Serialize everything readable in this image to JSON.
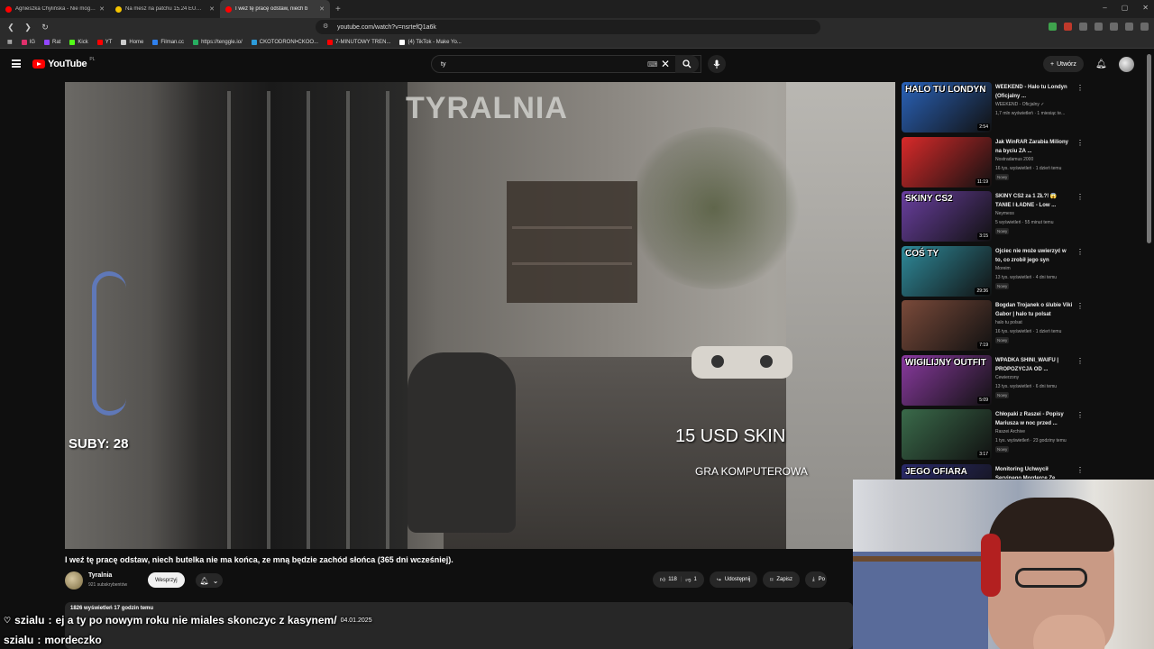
{
  "browser": {
    "tabs": [
      {
        "label": "Agnieszka Chylińska - Nie mogę Cię",
        "color": "#ff0000"
      },
      {
        "label": "Na mesz na patchu 15.24 EUW 767!",
        "color": "#f5c400"
      },
      {
        "label": "I weź tę pracę odstaw, niech b",
        "color": "#ff0000"
      }
    ],
    "active_tab": 2,
    "new_tab": "+",
    "window_controls": [
      "–",
      "▢",
      "✕"
    ],
    "url": "youtube.com/watch?v=nsrtefQ1a6k",
    "bookmarks": [
      {
        "label": "IG",
        "color": "#e1306c"
      },
      {
        "label": "Rat",
        "color": "#9146ff"
      },
      {
        "label": "Kick",
        "color": "#53fc18"
      },
      {
        "label": "YT",
        "color": "#ff0000"
      },
      {
        "label": "Home",
        "color": "#cccccc"
      },
      {
        "label": "Filman.cc",
        "color": "#2f80ed"
      },
      {
        "label": "https://tenggle.io/",
        "color": "#27ae60"
      },
      {
        "label": "CKOTODRONI•CKOO...",
        "color": "#2d9cdb"
      },
      {
        "label": "7-MINUTOWY TREN...",
        "color": "#ff0000"
      },
      {
        "label": "(4) TikTok - Make Yo...",
        "color": "#ffffff"
      }
    ]
  },
  "youtube": {
    "logo_text": "YouTube",
    "country": "PL",
    "search_value": "ty",
    "create_label": "Utwórz",
    "icons": [
      "menu-icon",
      "search-icon",
      "mic-icon",
      "bell-icon",
      "keyboard-icon",
      "clear-icon"
    ]
  },
  "video": {
    "overlay_channel": "TYRALNIA",
    "overlay_subs": "SUBY: 28",
    "overlay_skin": "15 USD SKIN",
    "overlay_game": "GRA KOMPUTEROWA",
    "title": "I weź tę pracę odstaw, niech butelka nie ma końca, ze mną będzie zachód słońca (365 dni wcześniej).",
    "channel": "Tyralnia",
    "subscribers": "921 subskrybentów",
    "support_label": "Wesprzyj",
    "likes": "118",
    "dislikes": "1",
    "share_label": "Udostępnij",
    "save_label": "Zapisz",
    "download_label": "Po",
    "desc_meta": "1826 wyświetleń  17 godzin temu"
  },
  "sidebar": {
    "items": [
      {
        "title": "WEEKEND - Halo tu Londyn (Oficjalny ...",
        "channel": "WEEKEND - Oficjalny ✓",
        "meta": "1,7 mln wyświetleń · 1 miesiąc te...",
        "duration": "2:54",
        "thumb_text": "HALO TU LONDYN",
        "thumb_bg": "#2a62b8",
        "badge": ""
      },
      {
        "title": "Jak WinRAR Zarabia Miliony na byciu ZA ...",
        "channel": "Nostradamus 2000",
        "meta": "16 tys. wyświetleń · 1 dzień temu",
        "duration": "11:19",
        "thumb_text": "",
        "thumb_bg": "#d92a2a",
        "badge": "Nowy"
      },
      {
        "title": "SKINY CS2 za 1 ZŁ?! 😱 TANIE I ŁADNE - Low ...",
        "channel": "Neymess",
        "meta": "5 wyświetleń · 55 minut temu",
        "duration": "3:15",
        "thumb_text": "SKINY CS2",
        "thumb_bg": "#6a3fa0",
        "badge": "Nowy"
      },
      {
        "title": "Ojciec nie może uwierzyć w to, co zrobił jego syn",
        "channel": "Moreim",
        "meta": "13 tys. wyświetleń · 4 dni temu",
        "duration": "29:36",
        "thumb_text": "COŚ TY",
        "thumb_bg": "#2f8a9a",
        "badge": "Nowy"
      },
      {
        "title": "Bogdan Trojanek o ślubie Viki Gabor | halo tu polsat",
        "channel": "halo tu polsat",
        "meta": "16 tys. wyświetleń · 1 dzień temu",
        "duration": "7:19",
        "thumb_text": "",
        "thumb_bg": "#7a4a3a",
        "badge": "Nowy"
      },
      {
        "title": "WPADKA SHINI_WAIFU | PROPOZYCJA OD ...",
        "channel": "Cewierzony",
        "meta": "13 tys. wyświetleń · 6 dni temu",
        "duration": "5:09",
        "thumb_text": "WIGILIJNY OUTFIT",
        "thumb_bg": "#8a3aa0",
        "badge": "Nowy"
      },
      {
        "title": "Chłopaki z Raszei - Popisy Mariusza w noc przed ...",
        "channel": "Raszei Archive",
        "meta": "1 tys. wyświetleń · 23 godziny temu",
        "duration": "3:17",
        "thumb_text": "",
        "thumb_bg": "#3a6a4a",
        "badge": "Nowy"
      },
      {
        "title": "Monitoring Uchwycił Seryjnego Mordercę Ze ...",
        "channel": "",
        "meta": "",
        "duration": "",
        "thumb_text": "JEGO OFIARA",
        "thumb_bg": "#2a2a6a",
        "badge": ""
      }
    ]
  },
  "chat": [
    {
      "user": "szialu",
      "message": "ej a ty po nowym roku nie miales skonczyc z kasynem/",
      "time": "04.01.2025"
    },
    {
      "user": "szialu",
      "message": "mordeczko",
      "time": ""
    }
  ]
}
